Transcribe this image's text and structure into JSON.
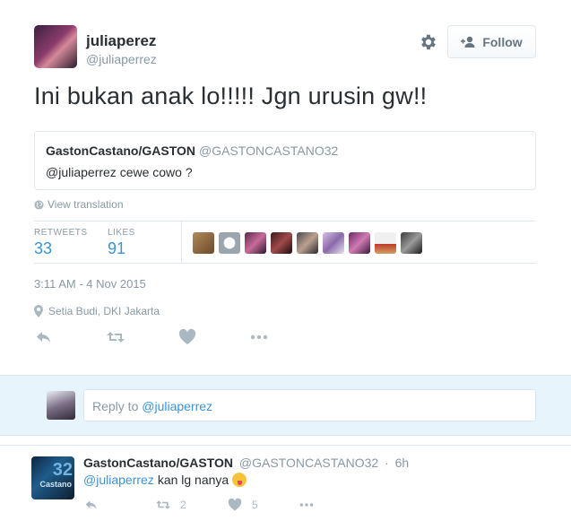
{
  "tweet": {
    "display_name": "juliaperez",
    "handle": "@juliaperrez",
    "follow_label": "Follow",
    "text": "Ini bukan anak lo!!!!! Jgn urusin gw!!",
    "quote": {
      "name": "GastonCastano/GASTON",
      "handle": "@GASTONCASTANO32",
      "text": "@juliaperrez cewe cowo ?"
    },
    "translate_label": "View translation",
    "retweets_label": "RETWEETS",
    "retweets_count": "33",
    "likes_label": "LIKES",
    "likes_count": "91",
    "timestamp": "3:11 AM - 4 Nov 2015",
    "location": "Setia Budi, DKI Jakarta"
  },
  "reply_box": {
    "prefix": "Reply to ",
    "mention": "@juliaperrez"
  },
  "reply_tweet": {
    "name": "GastonCastano/GASTON",
    "handle": "@GASTONCASTANO32",
    "separator": "·",
    "time": "6h",
    "mention": "@juliaperrez",
    "text": "kan lg nanya",
    "retweet_count": "2",
    "like_count": "5",
    "avatar_number": "32",
    "avatar_caption": "Castano"
  },
  "icons": {
    "gear": "gear-icon",
    "follow": "add-user-icon",
    "globe": "globe-icon",
    "location": "location-pin-icon",
    "reply": "reply-icon",
    "retweet": "retweet-icon",
    "like": "heart-icon",
    "more": "more-icon",
    "emoji": "tongue-emoji-icon"
  },
  "colors": {
    "link": "#3b94d9",
    "muted": "#8899a6",
    "text": "#292f33",
    "reply_bar": "#e8f4fb"
  }
}
